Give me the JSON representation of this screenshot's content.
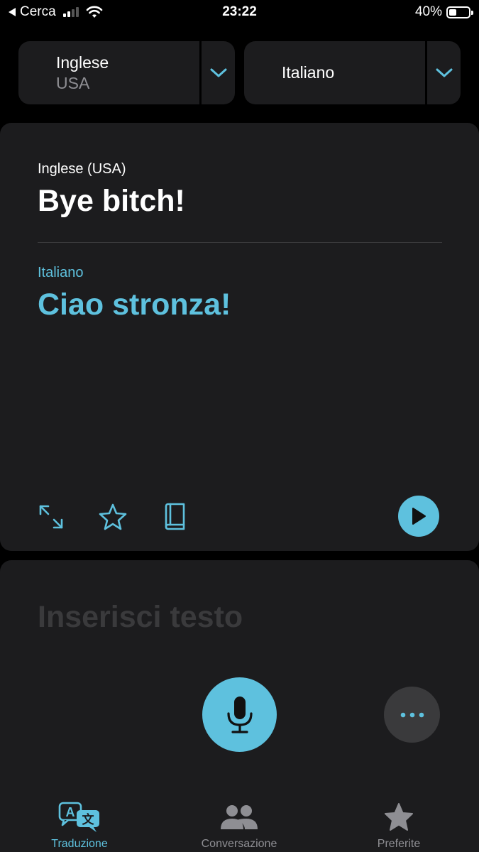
{
  "status_bar": {
    "back_label": "Cerca",
    "time": "23:22",
    "battery_percent": "40%",
    "battery_level": 0.4
  },
  "languages": {
    "source": {
      "name": "Inglese",
      "region": "USA"
    },
    "target": {
      "name": "Italiano"
    }
  },
  "translation": {
    "source_label": "Inglese (USA)",
    "source_text": "Bye bitch!",
    "target_label": "Italiano",
    "target_text": "Ciao stronza!"
  },
  "input": {
    "placeholder": "Inserisci testo"
  },
  "tabs": [
    {
      "label": "Traduzione",
      "icon": "translate-icon",
      "active": true
    },
    {
      "label": "Conversazione",
      "icon": "people-icon",
      "active": false
    },
    {
      "label": "Preferite",
      "icon": "star-filled-icon",
      "active": false
    }
  ],
  "colors": {
    "accent": "#5ec1de",
    "card": "#1c1c1e",
    "muted": "#8e8e93"
  }
}
